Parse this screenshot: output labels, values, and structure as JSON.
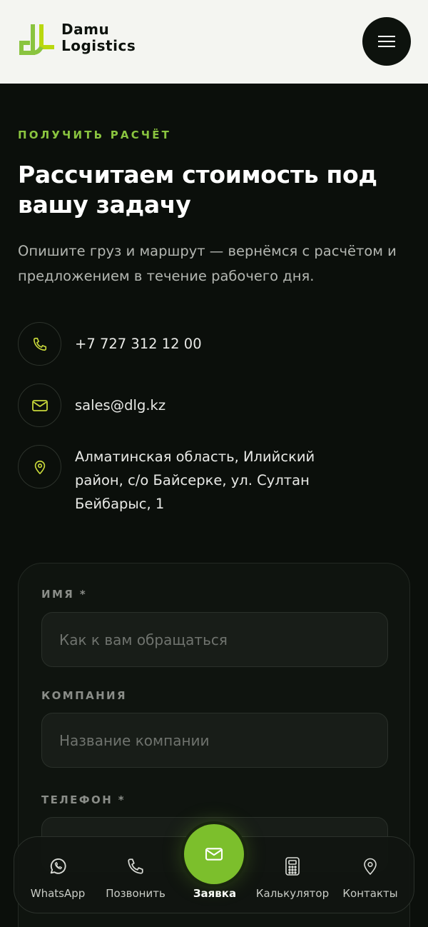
{
  "header": {
    "logo_line1": "Damu",
    "logo_line2": "Logistics"
  },
  "colors": {
    "accent": "#8ac43f",
    "fab": "#7cbf2c",
    "background": "#0b0f0b",
    "header_bg": "#f4f5f1"
  },
  "hero": {
    "eyebrow": "ПОЛУЧИТЬ РАСЧЁТ",
    "title": "Рассчитаем стоимость под вашу задачу",
    "lead": "Опишите груз и маршрут — вернёмся с расчётом и предложением в течение рабочего дня."
  },
  "contacts": [
    {
      "icon": "phone-icon",
      "text": "+7 727 312 12 00"
    },
    {
      "icon": "mail-icon",
      "text": "sales@dlg.kz"
    },
    {
      "icon": "location-pin-icon",
      "text": "Алматинская область, Илийский район, с/о Байсерке, ул. Султан Бейбарыс, 1"
    }
  ],
  "form": {
    "name_label": "ИМЯ *",
    "name_placeholder": "Как к вам обращаться",
    "company_label": "КОМПАНИЯ",
    "company_placeholder": "Название компании",
    "phone_label": "ТЕЛЕФОН *",
    "phone_placeholder": ""
  },
  "bottom_nav": {
    "whatsapp": "WhatsApp",
    "call": "Позвонить",
    "request": "Заявка",
    "calculator": "Калькулятор",
    "contacts": "Контакты"
  }
}
